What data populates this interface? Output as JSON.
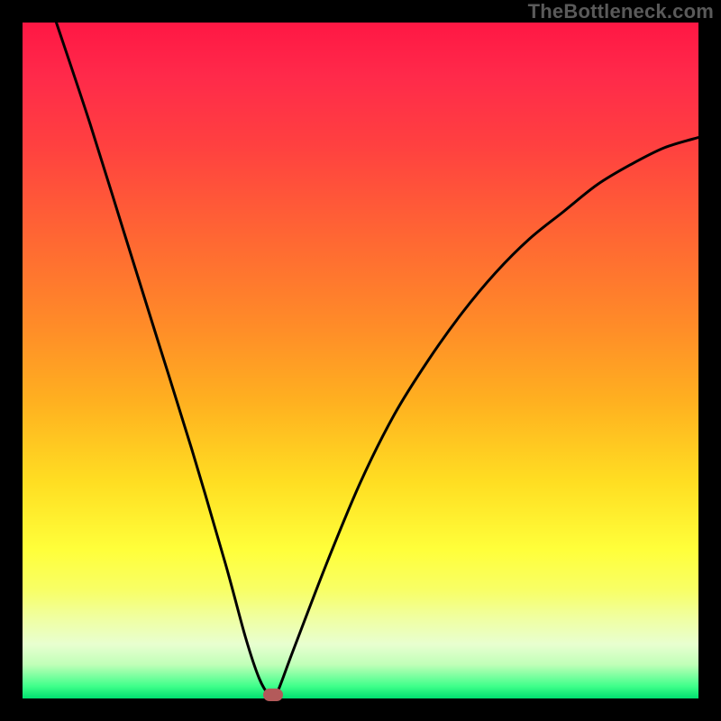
{
  "watermark": "TheBottleneck.com",
  "chart_data": {
    "type": "line",
    "title": "",
    "xlabel": "",
    "ylabel": "",
    "xlim": [
      0,
      100
    ],
    "ylim": [
      0,
      100
    ],
    "grid": false,
    "legend": false,
    "background_gradient": {
      "top": "#ff1744",
      "mid": "#ffde22",
      "bottom": "#00e070"
    },
    "series": [
      {
        "name": "bottleneck-curve",
        "color": "#000000",
        "x": [
          5,
          10,
          15,
          20,
          25,
          30,
          33,
          35,
          36.5,
          37.5,
          40,
          45,
          50,
          55,
          60,
          65,
          70,
          75,
          80,
          85,
          90,
          95,
          100
        ],
        "y": [
          100,
          85,
          69,
          53,
          37,
          20,
          9,
          3,
          0.5,
          0.5,
          7,
          20,
          32,
          42,
          50,
          57,
          63,
          68,
          72,
          76,
          79,
          81.5,
          83
        ]
      }
    ],
    "marker": {
      "x": 37,
      "y": 0.5,
      "color": "#b35a5a"
    }
  }
}
